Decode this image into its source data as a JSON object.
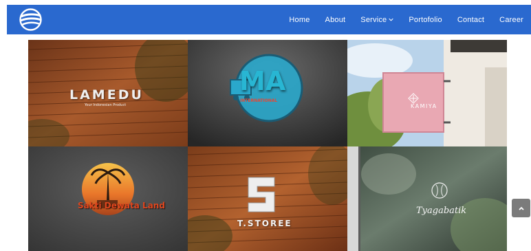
{
  "nav": {
    "logo": "globe-logo",
    "links": [
      {
        "label": "Home"
      },
      {
        "label": "About"
      },
      {
        "label": "Service",
        "has_dropdown": true
      },
      {
        "label": "Portofolio"
      },
      {
        "label": "Contact"
      },
      {
        "label": "Career"
      }
    ],
    "bg_color": "#2a69cf"
  },
  "gallery": {
    "items": [
      {
        "name": "LAMEDU",
        "tagline": "Your Indonesian Product"
      },
      {
        "name": "MA",
        "tagline": "INTERNATIONAL"
      },
      {
        "name": "KAMIYA"
      },
      {
        "name": "Sakti Dewata Land"
      },
      {
        "name": "T.STOREE"
      },
      {
        "name": "Tyagabatik"
      }
    ]
  },
  "scroll_top": {
    "icon": "chevron-up-icon"
  }
}
